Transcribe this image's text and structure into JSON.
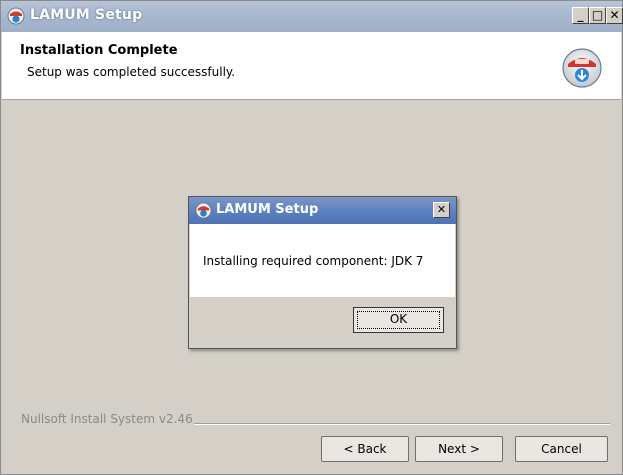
{
  "window": {
    "title": "LAMUM Setup",
    "minimize_glyph": "_",
    "maximize_glyph": "□",
    "close_glyph": "✕"
  },
  "header": {
    "title": "Installation Complete",
    "subtitle": "Setup was completed successfully.",
    "icon": "installer-icon"
  },
  "footer": {
    "branding": "Nullsoft Install System v2.46",
    "back_label": "< Back",
    "next_label": "Next >",
    "cancel_label": "Cancel"
  },
  "dialog": {
    "title": "LAMUM Setup",
    "close_glyph": "✕",
    "message": "Installing required component: JDK 7",
    "ok_label": "OK"
  },
  "colors": {
    "title_bar": "#a6b6cd",
    "dialog_title_bar": "#5b7fbd",
    "panel": "#d4d0c8"
  }
}
